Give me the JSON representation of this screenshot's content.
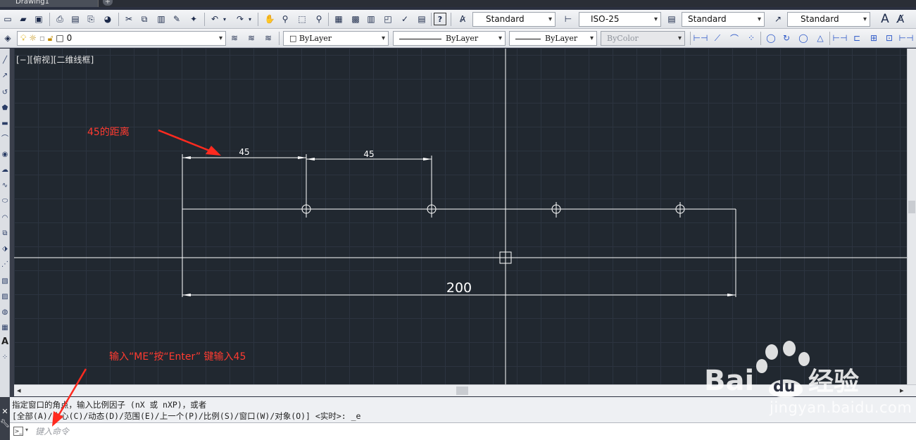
{
  "window": {
    "doc_tab": "Drawing1",
    "new_tab": "+"
  },
  "toolbar1": {
    "text_style": "Standard",
    "dim_style": "ISO-25",
    "table_style": "Standard",
    "mleader_style": "Standard",
    "help_label": "?"
  },
  "toolbar2": {
    "layer_name": "0",
    "color": "ByLayer",
    "linetype": "ByLayer",
    "lineweight": "ByLayer",
    "plot_style": "ByColor"
  },
  "viewport": {
    "label": "[−][俯视][二维线框]"
  },
  "drawing": {
    "dim_top_left": "45",
    "dim_top_right": "45",
    "dim_bottom": "200"
  },
  "annotations": {
    "top": "45的距离",
    "bottom": "输入“ME”按“Enter” 键输入45"
  },
  "command": {
    "history_line1": "指定窗口的角点，输入比例因子 (nX 或 nXP)，或者",
    "history_line2": "[全部(A)/中心(C)/动态(D)/范围(E)/上一个(P)/比例(S)/窗口(W)/对象(O)] <实时>: _e",
    "placeholder": "键入命令"
  },
  "watermark": {
    "brand_left": "Bai",
    "brand_right": "du",
    "brand_cn": "经验",
    "url": "jingyan.baidu.com"
  },
  "colors": {
    "canvas": "#212830",
    "geometry": "#ffffff",
    "annotation": "#ff3b30",
    "toolbar": "#e6e8ec"
  },
  "icons": {
    "toolbar1": [
      "new-icon",
      "open-icon",
      "save-icon",
      "print-icon",
      "preview-icon",
      "publish-icon",
      "3d-print-icon",
      "cut-icon",
      "copy-icon",
      "paste-icon",
      "match-properties-icon",
      "block-editor-icon",
      "undo-icon",
      "redo-icon",
      "pan-icon",
      "zoom-realtime-icon",
      "zoom-window-icon",
      "zoom-previous-icon",
      "properties-icon",
      "design-center-icon",
      "tool-palettes-icon",
      "sheet-set-icon",
      "markup-icon",
      "quickcalc-icon",
      "help-icon"
    ],
    "toolbar2_dims": [
      "dim-linear-icon",
      "dim-aligned-icon",
      "dim-arc-icon",
      "dim-ordinate-icon",
      "dim-radius-icon",
      "dim-jogged-icon",
      "dim-diameter-icon",
      "dim-angular-icon",
      "qdim-icon",
      "dim-baseline-icon",
      "dim-continue-icon",
      "dim-space-icon"
    ],
    "left_palette": [
      "line-icon",
      "construction-line-icon",
      "polyline-icon",
      "polygon-icon",
      "rectangle-icon",
      "arc-icon",
      "circle-icon",
      "revcloud-icon",
      "spline-icon",
      "ellipse-icon",
      "ellipse-arc-icon",
      "insert-block-icon",
      "make-block-icon",
      "point-icon",
      "hatch-icon",
      "gradient-icon",
      "region-icon",
      "table-icon",
      "mtext-icon",
      "add-selected-icon"
    ]
  }
}
